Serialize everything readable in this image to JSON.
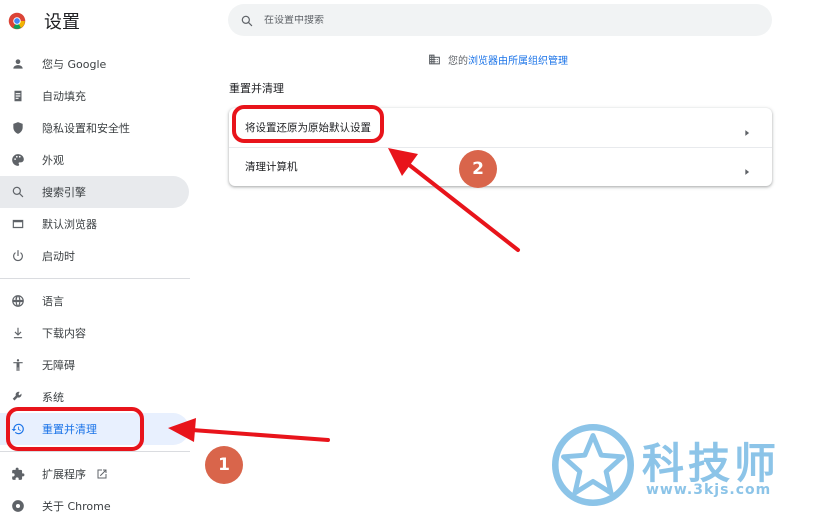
{
  "header": {
    "title": "设置"
  },
  "search": {
    "placeholder": "在设置中搜索"
  },
  "managed_notice": {
    "prefix": "您的",
    "link": "浏览器由所属组织管理"
  },
  "sidebar": {
    "items": [
      {
        "label": "您与 Google",
        "icon": "person-icon"
      },
      {
        "label": "自动填充",
        "icon": "clipboard-icon"
      },
      {
        "label": "隐私设置和安全性",
        "icon": "shield-icon"
      },
      {
        "label": "外观",
        "icon": "palette-icon"
      },
      {
        "label": "搜索引擎",
        "icon": "search-icon"
      },
      {
        "label": "默认浏览器",
        "icon": "browser-icon"
      },
      {
        "label": "启动时",
        "icon": "power-icon"
      },
      {
        "label": "语言",
        "icon": "globe-icon"
      },
      {
        "label": "下载内容",
        "icon": "download-icon"
      },
      {
        "label": "无障碍",
        "icon": "accessibility-icon"
      },
      {
        "label": "系统",
        "icon": "wrench-icon"
      },
      {
        "label": "重置并清理",
        "icon": "history-icon"
      },
      {
        "label": "扩展程序",
        "icon": "puzzle-icon"
      },
      {
        "label": "关于 Chrome",
        "icon": "chrome-icon"
      }
    ]
  },
  "main": {
    "section_title": "重置并清理",
    "rows": [
      {
        "label": "将设置还原为原始默认设置"
      },
      {
        "label": "清理计算机"
      }
    ]
  },
  "annotations": {
    "step1": "1",
    "step2": "2"
  },
  "watermark": {
    "name": "科技师",
    "url": "www.3kjs.com"
  },
  "colors": {
    "accent": "#1a73e8",
    "annotation_red": "#e8141b",
    "badge": "#d9654b",
    "watermark": "#8cc4e8"
  }
}
